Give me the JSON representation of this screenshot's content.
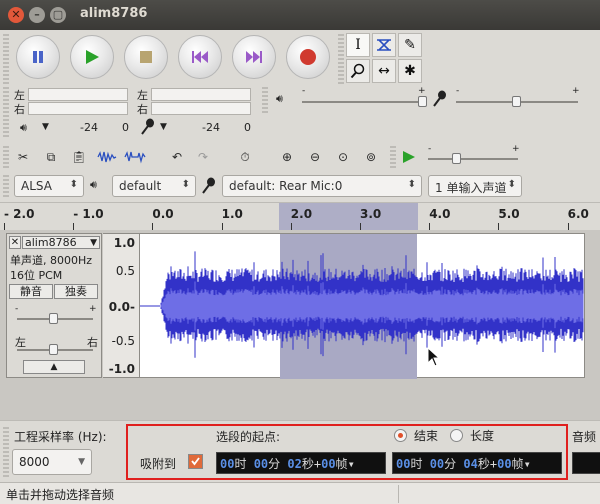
{
  "window": {
    "title": "alim8786"
  },
  "transport": {
    "pause": "pause-icon",
    "play": "play-icon",
    "stop": "stop-icon",
    "skip_start": "skip-start-icon",
    "skip_end": "skip-end-icon",
    "record": "record-icon"
  },
  "tools": {
    "selection": "I",
    "envelope": "envelope-icon",
    "draw": "✎",
    "zoom": "zoom-icon",
    "timeshift": "↔",
    "multi": "✱"
  },
  "meters": {
    "left": "左",
    "right": "右",
    "play_db_min": "-24",
    "play_db_zero": "0",
    "rec_db_min": "-24",
    "rec_db_zero": "0",
    "minus": "-",
    "plus": "+"
  },
  "devices": {
    "host": "ALSA",
    "output": "default",
    "input": "default: Rear Mic:0",
    "channels": "1 单输入声道"
  },
  "ruler": {
    "ticks": [
      "- 2.0",
      "- 1.0",
      "0.0",
      "1.0",
      "2.0",
      "3.0",
      "4.0",
      "5.0",
      "6.0"
    ]
  },
  "track": {
    "name": "alim8786",
    "info_line1": "单声道, 8000Hz",
    "info_line2": "16位 PCM",
    "mute": "静音",
    "solo": "独奏",
    "gain_minus": "-",
    "gain_plus": "+",
    "pan_left": "左",
    "pan_right": "右",
    "scale": [
      "1.0",
      "0.5",
      "0.0-",
      "-0.5",
      "-1.0"
    ]
  },
  "selection": {
    "rate_label": "工程采样率 (Hz):",
    "rate_value": "8000",
    "snap_label": "吸附到",
    "start_label": "选段的起点:",
    "end_label": "结束",
    "length_label": "长度",
    "audio_cut": "音频",
    "start_time": {
      "h": "00",
      "h_unit": "时",
      "m": "00",
      "m_unit": "分",
      "s": "02",
      "s_unit": "秒+",
      "f": "00",
      "f_unit": "帧"
    },
    "end_time": {
      "h": "00",
      "h_unit": "时",
      "m": "00",
      "m_unit": "分",
      "s": "04",
      "s_unit": "秒+",
      "f": "00",
      "f_unit": "帧"
    }
  },
  "status": {
    "text": "单击并拖动选择音频"
  },
  "colors": {
    "wave": "#3232c8",
    "wave_light": "#6e6ee6",
    "selection": "#a9a9c4",
    "record_red": "#d03a2f",
    "play_green": "#2aa22a",
    "highlight_box": "#e0201e"
  }
}
